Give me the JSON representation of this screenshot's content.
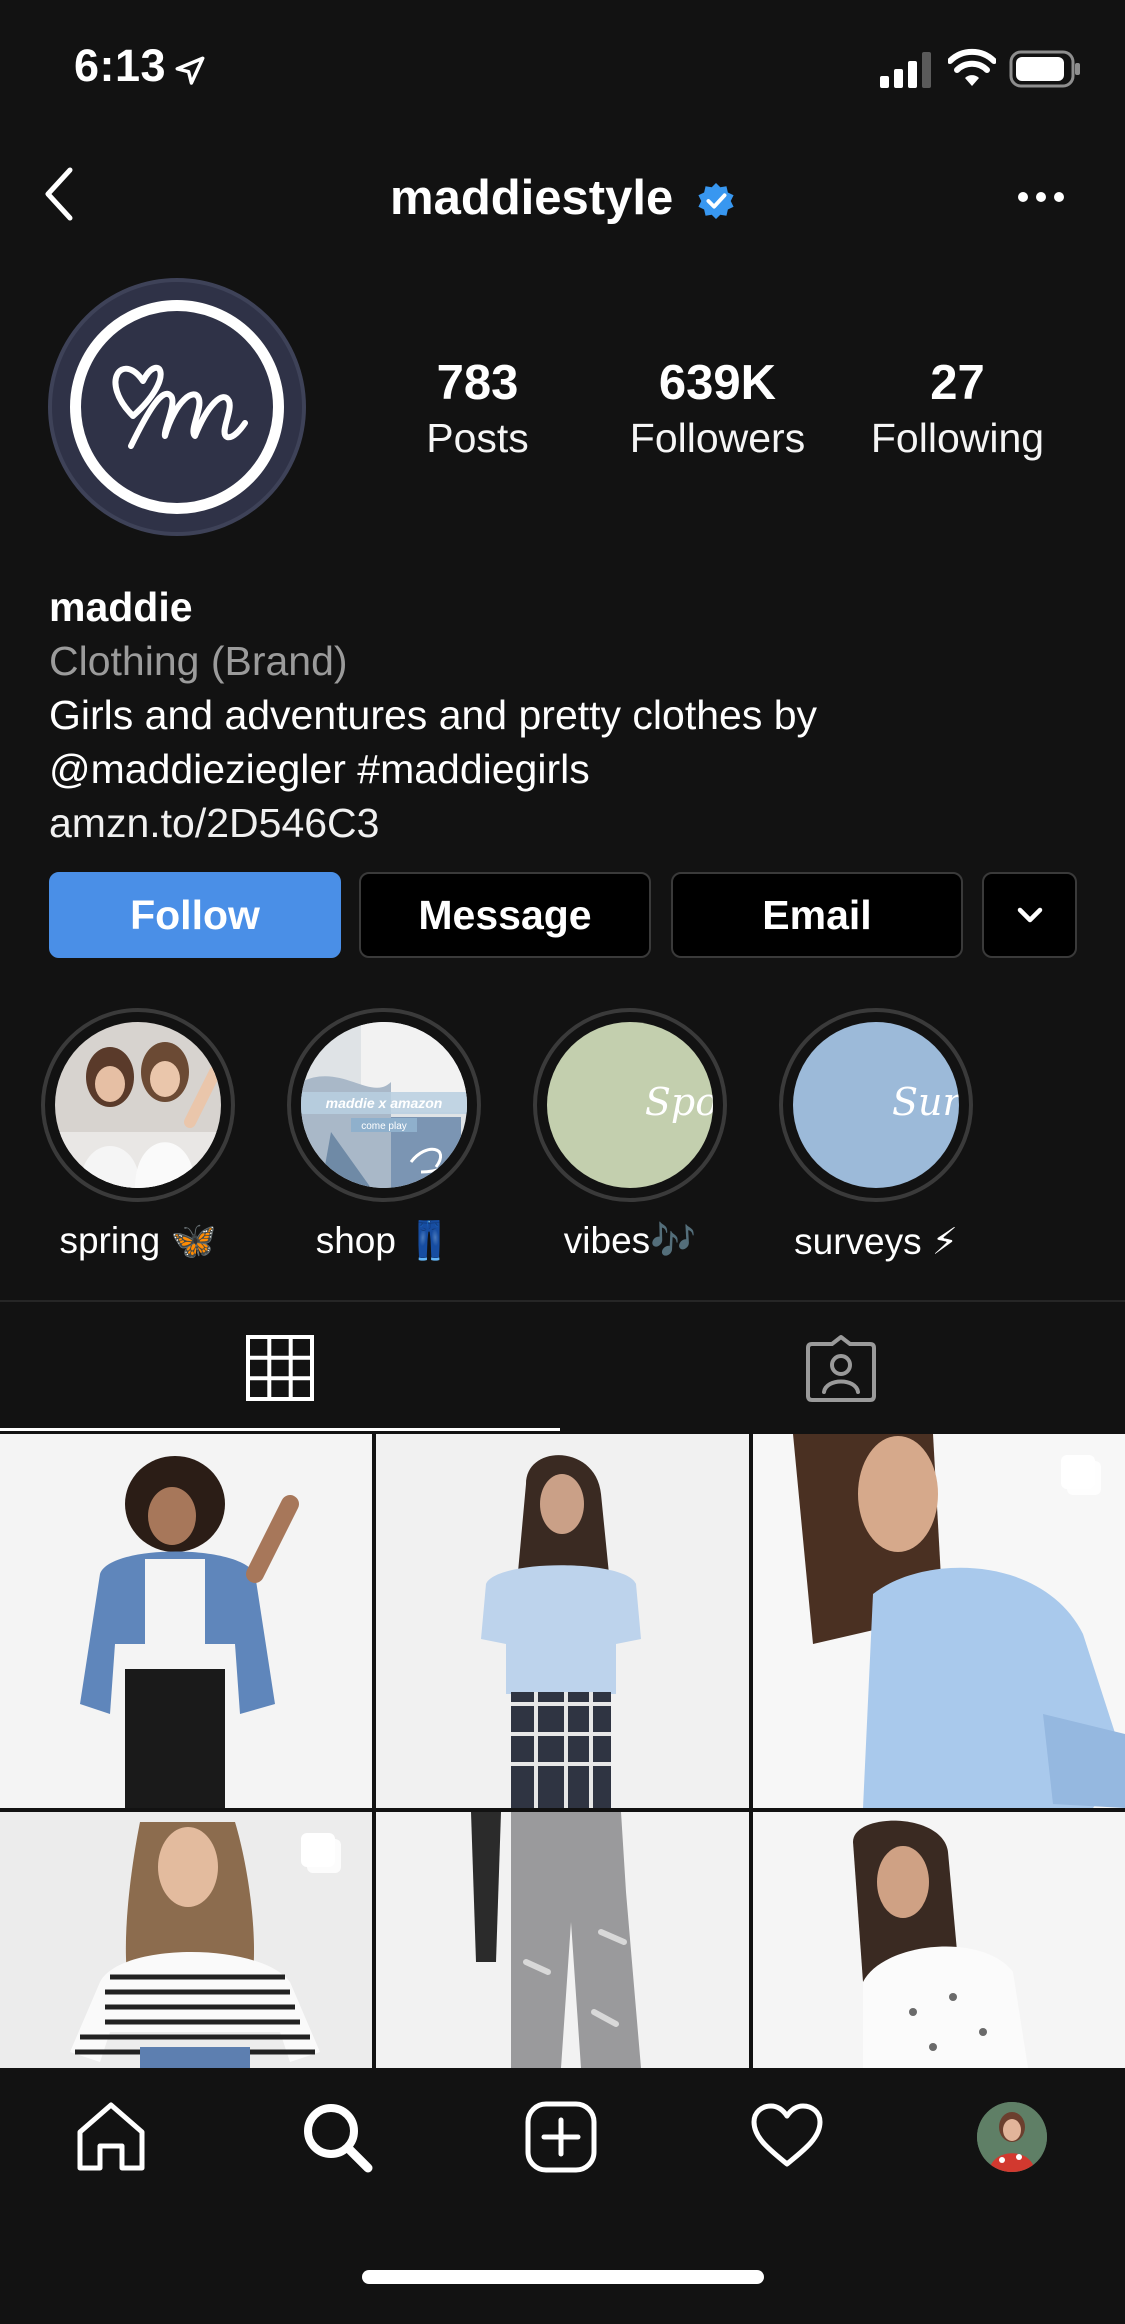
{
  "status_bar": {
    "time": "6:13"
  },
  "header": {
    "username": "maddiestyle"
  },
  "stats": {
    "posts": {
      "value": "783",
      "label": "Posts"
    },
    "followers": {
      "value": "639K",
      "label": "Followers"
    },
    "following": {
      "value": "27",
      "label": "Following"
    }
  },
  "bio": {
    "name": "maddie",
    "category": "Clothing (Brand)",
    "line1": "Girls and adventures and pretty clothes by",
    "line2": "@maddieziegler #maddiegirls",
    "link": "amzn.to/2D546C3"
  },
  "buttons": {
    "follow": "Follow",
    "message": "Message",
    "email": "Email"
  },
  "highlights": [
    {
      "label": "spring 🦋"
    },
    {
      "label": "shop 👖",
      "caption": "maddie x amazon",
      "subcaption": "come play"
    },
    {
      "label": "vibes🎶",
      "script": "Spotify"
    },
    {
      "label": "surveys ⚡",
      "script": "Survey"
    }
  ],
  "colors": {
    "background": "#121212",
    "follow_button": "#4a8fe7",
    "verified": "#3897f0",
    "category_text": "#9b9b9b",
    "highlight_vibes": "#c3cfae",
    "highlight_surveys": "#9cbad9"
  },
  "icons": {
    "tabs": [
      "grid-icon",
      "tagged-icon"
    ],
    "bottom_nav": [
      "home-icon",
      "search-icon",
      "new-post-icon",
      "activity-heart-icon",
      "profile-avatar"
    ]
  }
}
